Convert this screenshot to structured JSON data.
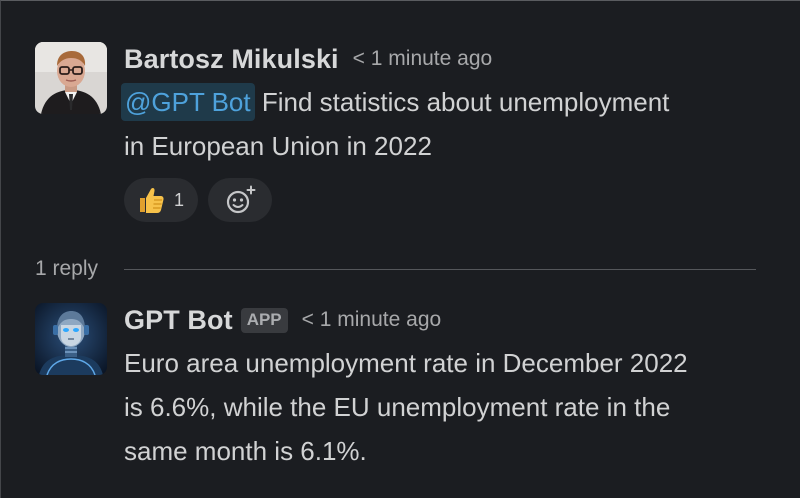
{
  "messages": [
    {
      "author": "Bartosz Mikulski",
      "timestamp": "< 1 minute ago",
      "mention": "@GPT Bot",
      "text_line1": "Find statistics about unemployment",
      "text_line2": "in European Union in 2022",
      "reactions": [
        {
          "emoji": "thumbs-up",
          "count": "1"
        }
      ]
    },
    {
      "author": "GPT Bot",
      "badge": "APP",
      "timestamp": "< 1 minute ago",
      "text_line1": "Euro area unemployment rate in December 2022",
      "text_line2": "is 6.6%, while the EU unemployment rate in the",
      "text_line3": "same month is 6.1%."
    }
  ],
  "thread": {
    "reply_count": "1 reply"
  },
  "colors": {
    "background": "#1b1d21",
    "mention_text": "#4ea2dc",
    "mention_bg": "#1f3a4a",
    "reaction_bg": "#2a2c30"
  }
}
